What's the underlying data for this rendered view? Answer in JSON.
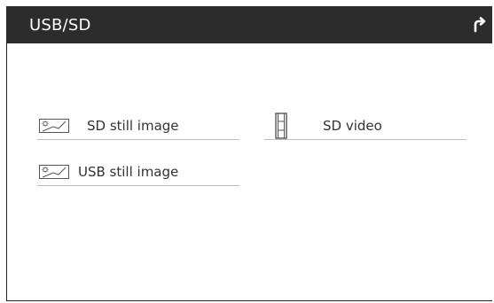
{
  "header": {
    "title": "USB/SD",
    "back_icon": "return-arrow-icon"
  },
  "items": [
    {
      "label": "SD still image",
      "icon": "still-image-icon"
    },
    {
      "label": "SD video",
      "icon": "film-strip-icon"
    },
    {
      "label": "USB still image",
      "icon": "still-image-icon"
    }
  ],
  "colors": {
    "header_bg": "#2c2c2c",
    "header_text": "#ffffff",
    "item_text": "#333333",
    "divider": "#bdbdbd",
    "icon_stroke": "#555555"
  }
}
